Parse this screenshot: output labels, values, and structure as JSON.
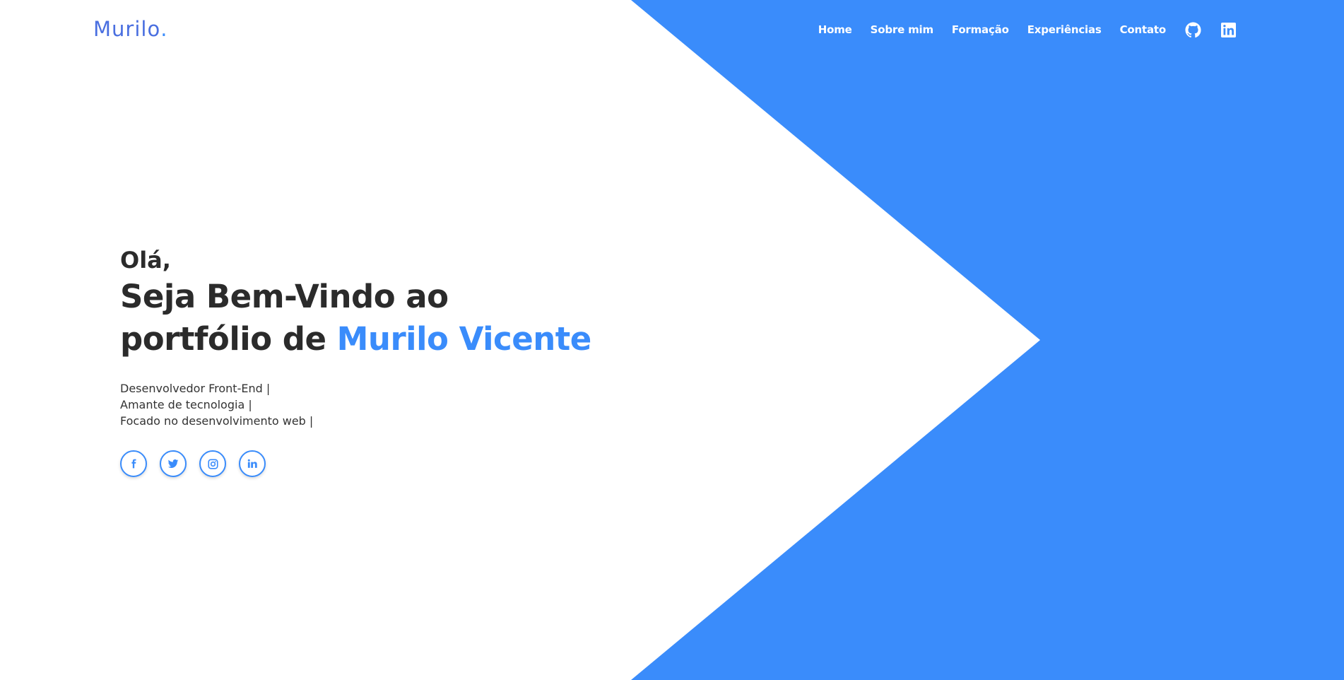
{
  "brand": {
    "name": "Murilo",
    "dot": "."
  },
  "nav": {
    "items": [
      {
        "label": "Home"
      },
      {
        "label": "Sobre mim"
      },
      {
        "label": "Formação"
      },
      {
        "label": "Experiências"
      },
      {
        "label": "Contato"
      }
    ],
    "icons": [
      "github-icon",
      "linkedin-icon"
    ]
  },
  "hero": {
    "greeting": "Olá,",
    "headline_line1": "Seja Bem-Vindo ao",
    "headline_line2_prefix": "portfólio de ",
    "headline_name": "Murilo Vicente",
    "taglines": [
      "Desenvolvedor Front-End |",
      "Amante de tecnologia |",
      "Focado no desenvolvimento web |"
    ]
  },
  "socials": [
    "facebook-icon",
    "twitter-icon",
    "instagram-icon",
    "linkedin-icon"
  ],
  "colors": {
    "accent": "#3a8cfb",
    "logo": "#4a6fe0",
    "text_dark": "#2b2b2b",
    "background": "#ffffff"
  }
}
